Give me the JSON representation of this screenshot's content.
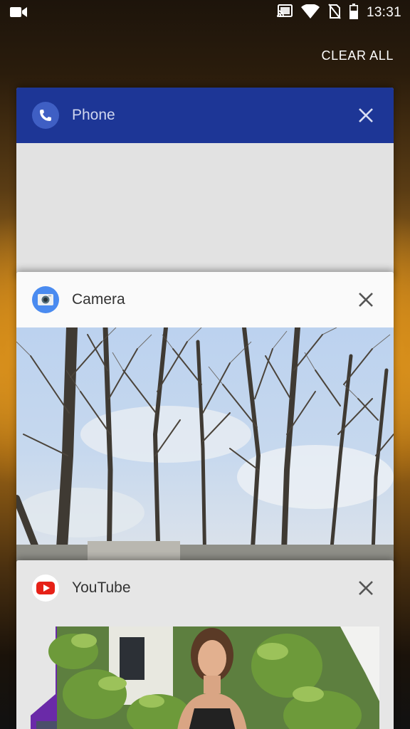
{
  "status_bar": {
    "time": "13:31",
    "icons": [
      "video-camera-icon",
      "cast-icon",
      "wifi-icon",
      "no-sim-icon",
      "battery-icon"
    ]
  },
  "recents": {
    "clear_all_label": "CLEAR ALL",
    "cards": [
      {
        "app": "Phone",
        "icon": "phone-icon",
        "header_color": "#1d3696"
      },
      {
        "app": "Camera",
        "icon": "camera-icon",
        "header_color": "#fafafa"
      },
      {
        "app": "YouTube",
        "icon": "youtube-icon",
        "header_color": "#e6e6e6"
      }
    ]
  },
  "colors": {
    "phone_header": "#1d3696",
    "youtube_red": "#e62117",
    "camera_blue": "#4285f4"
  }
}
